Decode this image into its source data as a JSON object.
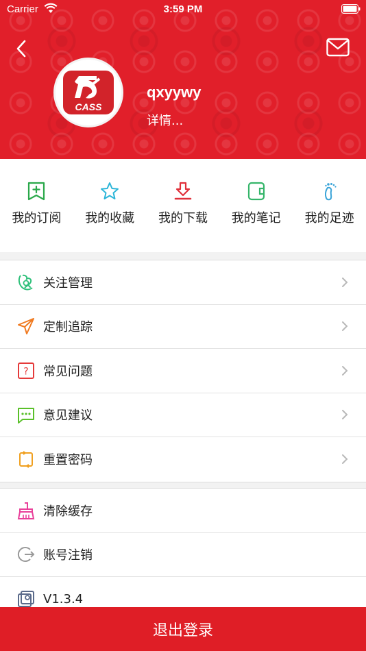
{
  "status_bar": {
    "carrier": "Carrier",
    "time": "3:59 PM"
  },
  "profile": {
    "username": "qxyywy",
    "details": "详情...",
    "logo_text": "CASS"
  },
  "quick_nav": [
    {
      "label": "我的订阅",
      "icon": "subscription-icon",
      "color": "#2aa84a"
    },
    {
      "label": "我的收藏",
      "icon": "star-icon",
      "color": "#2bb5d8"
    },
    {
      "label": "我的下载",
      "icon": "download-icon",
      "color": "#e0303a"
    },
    {
      "label": "我的笔记",
      "icon": "notes-icon",
      "color": "#35b56a"
    },
    {
      "label": "我的足迹",
      "icon": "footprint-icon",
      "color": "#3aa4d8"
    }
  ],
  "menu": [
    {
      "label": "关注管理",
      "icon": "follow-icon",
      "color": "#2ec07a"
    },
    {
      "label": "定制追踪",
      "icon": "send-icon",
      "color": "#f07a20"
    },
    {
      "label": "常见问题",
      "icon": "question-icon",
      "color": "#e53a3a"
    },
    {
      "label": "意见建议",
      "icon": "feedback-icon",
      "color": "#5ac02a"
    },
    {
      "label": "重置密码",
      "icon": "reset-icon",
      "color": "#f0a020"
    }
  ],
  "menu2": [
    {
      "label": "清除缓存",
      "icon": "broom-icon",
      "color": "#e9409a"
    },
    {
      "label": "账号注销",
      "icon": "logout-circle-icon",
      "color": "#999999"
    },
    {
      "label": "V1.3.4",
      "icon": "version-icon",
      "color": "#5a6a8a"
    }
  ],
  "logout_label": "退出登录",
  "colors": {
    "brand_red": "#e11f2a",
    "logout_red": "#df1e26"
  }
}
